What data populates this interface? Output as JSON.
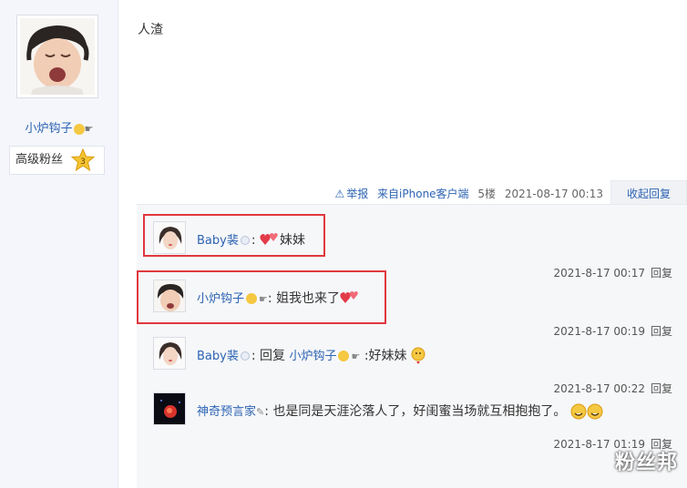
{
  "author": {
    "name": "小炉钩子",
    "fan_level_label": "高级粉丝",
    "fan_level": "3"
  },
  "post": {
    "content": "人渣",
    "report_label": "举报",
    "source": "来自iPhone客户端",
    "floor": "5楼",
    "time": "2021-08-17 00:13",
    "collapse_label": "收起回复"
  },
  "replies": [
    {
      "user": "Baby裴",
      "sep": ":",
      "text": "妹妹",
      "time": "2021-8-17 00:17",
      "reply_label": "回复"
    },
    {
      "user": "小炉钩子",
      "sep": ":",
      "text": "姐我也来了",
      "time": "2021-8-17 00:19",
      "reply_label": "回复"
    },
    {
      "user": "Baby裴",
      "sep": ":",
      "prefix": "回复",
      "target": "小炉钩子",
      "text": ":好妹妹",
      "time": "2021-8-17 00:22",
      "reply_label": "回复"
    },
    {
      "user": "神奇预言家",
      "sep": ":",
      "text": "也是同是天涯沦落人了，好闺蜜当场就互相抱抱了。",
      "time": "2021-8-17 01:19",
      "reply_label": "回复"
    }
  ],
  "watermark": "粉丝邦",
  "colors": {
    "link": "#2d64b3",
    "highlight": "#e0383e",
    "reply_bg": "#f6f7f9"
  }
}
